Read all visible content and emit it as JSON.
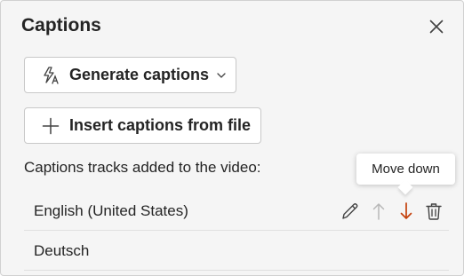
{
  "panel": {
    "title": "Captions",
    "close_icon": "close-icon"
  },
  "buttons": {
    "generate_label": "Generate captions",
    "generate_icon": "auto-captions-icon",
    "insert_label": "Insert captions from file",
    "insert_icon": "plus-icon"
  },
  "tracks": {
    "heading": "Captions tracks added to the video:",
    "items": [
      {
        "label": "English (United States)"
      },
      {
        "label": "Deutsch"
      }
    ],
    "actions": [
      "edit-icon",
      "move-up-icon",
      "move-down-icon",
      "delete-icon"
    ]
  },
  "tooltip": {
    "text": "Move down"
  },
  "colors": {
    "accent_active": "#c4410c",
    "disabled": "#b8b8b8",
    "panel_bg": "#f5f5f5"
  }
}
